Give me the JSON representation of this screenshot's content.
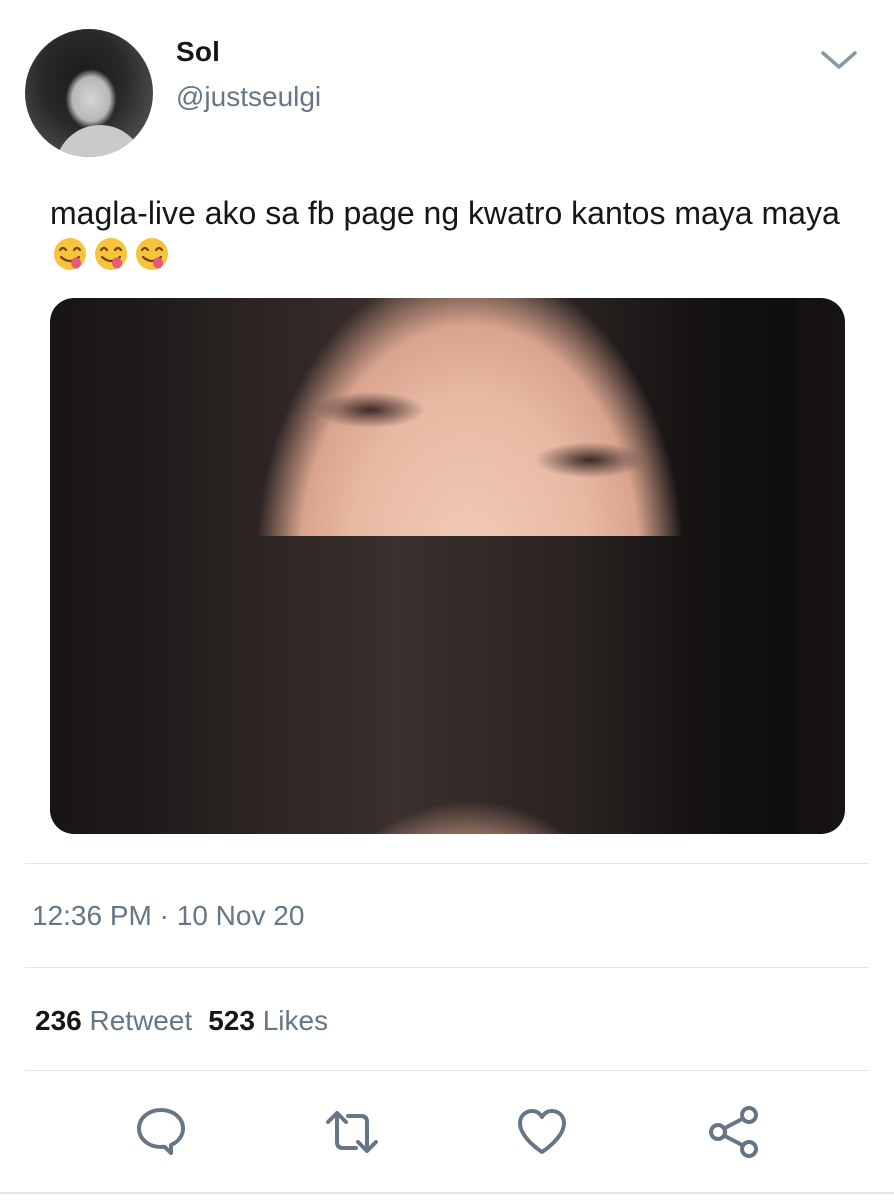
{
  "user": {
    "display_name": "Sol",
    "handle": "@justseulgi",
    "avatar_icon": "profile-photo"
  },
  "menu": {
    "icon": "chevron-down-icon"
  },
  "tweet": {
    "text": "magla-live ako sa fb page ng kwatro kantos maya maya",
    "emojis": [
      "face-savoring-food",
      "face-savoring-food",
      "face-savoring-food"
    ],
    "media_icon": "photo-selfie"
  },
  "meta": {
    "time": "12:36 PM",
    "separator": "·",
    "date": "10 Nov 20"
  },
  "stats": {
    "retweets_count": "236",
    "retweets_label": "Retweet",
    "likes_count": "523",
    "likes_label": "Likes"
  },
  "actions": {
    "reply_icon": "reply-icon",
    "retweet_icon": "retweet-icon",
    "like_icon": "heart-icon",
    "share_icon": "share-icon"
  },
  "colors": {
    "text_primary": "#14171a",
    "text_secondary": "#657786",
    "divider": "#e1e8ed",
    "icon": "#657786",
    "emoji_face": "#f7c33a",
    "emoji_tongue": "#e85a7a"
  }
}
